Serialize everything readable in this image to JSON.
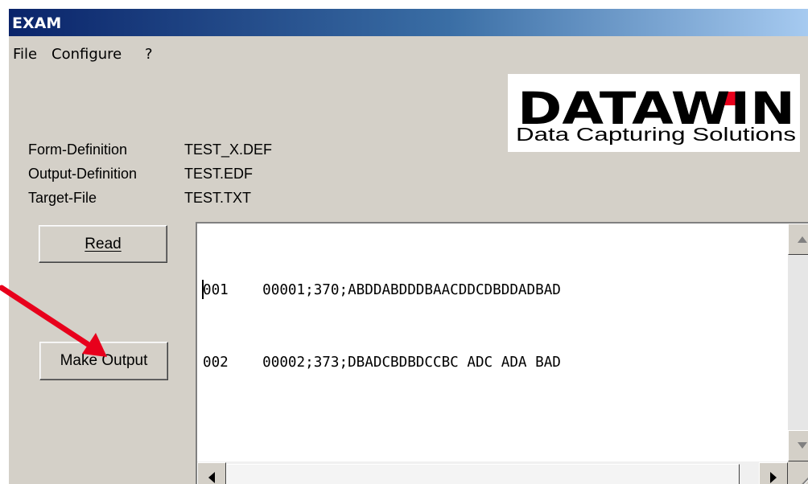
{
  "window": {
    "title": "EXAM"
  },
  "menu": {
    "items": [
      "File",
      "Configure",
      "?"
    ]
  },
  "logo": {
    "wordmark": "DATAWIN",
    "tagline": "Data Capturing Solutions"
  },
  "info": {
    "rows": [
      {
        "label": "Form-Definition",
        "value": "TEST_X.DEF"
      },
      {
        "label": "Output-Definition",
        "value": "TEST.EDF"
      },
      {
        "label": "Target-File",
        "value": "TEST.TXT"
      }
    ]
  },
  "buttons": {
    "read_label": "Read",
    "make_output_label": "Make Output"
  },
  "output_text": {
    "lines": [
      "001    00001;370;ABDDABDDDBAACDDCDBDDADBAD",
      "002    00002;373;DBADCBDBDCCBC ADC ADA BAD"
    ]
  },
  "colors": {
    "title_start": "#0a246a",
    "title_end": "#a6caf0",
    "window_face": "#d4d0c8",
    "logo_text": "#000000",
    "logo_accent": "#e8001c",
    "annotation_arrow": "#e8001c"
  }
}
